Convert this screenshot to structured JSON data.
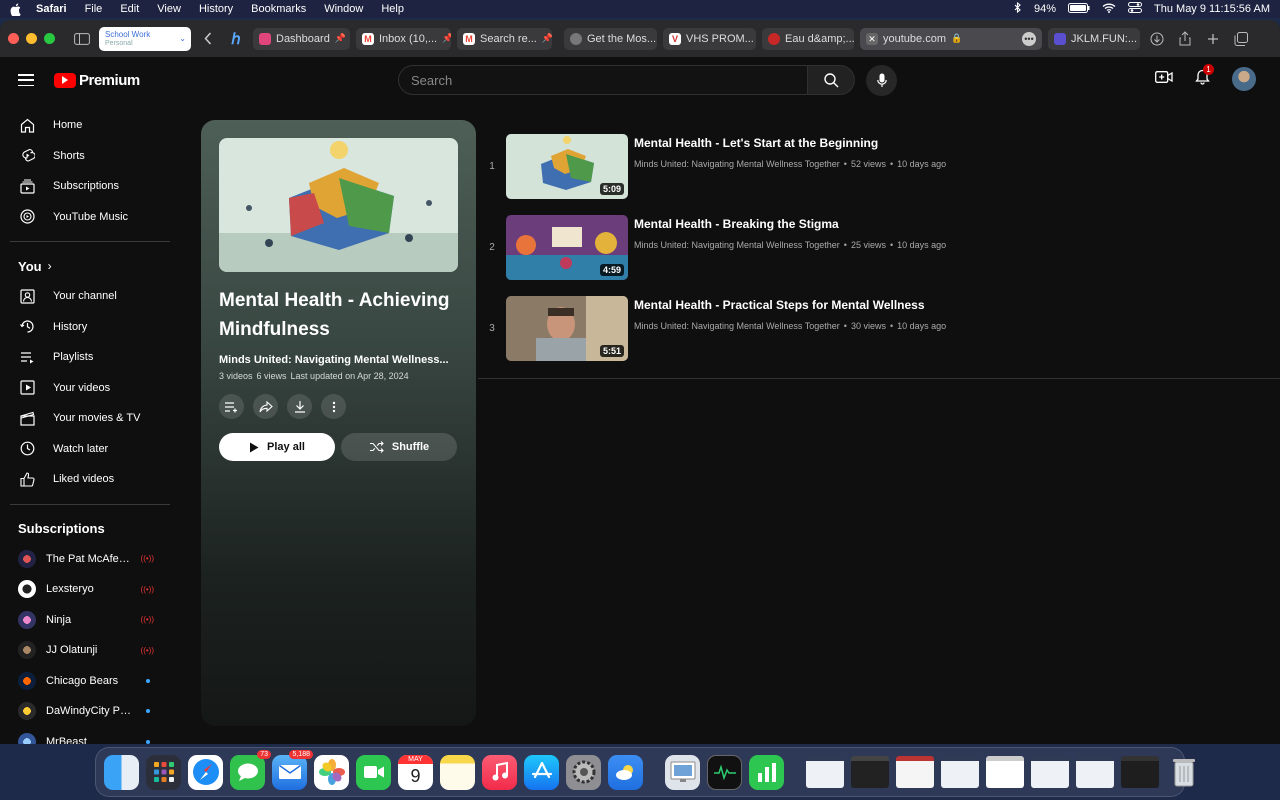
{
  "menubar": {
    "app": "Safari",
    "items": [
      "File",
      "Edit",
      "View",
      "History",
      "Bookmarks",
      "Window",
      "Help"
    ],
    "battery": "94%",
    "datetime": "Thu May 9  11:15:56 AM"
  },
  "browser": {
    "profile": {
      "name": "School Work",
      "sub": "Personal"
    },
    "tabs": [
      {
        "label": "Dashboard",
        "color": "#e0457b"
      },
      {
        "label": "Inbox (10,...",
        "color": "#ea4335"
      },
      {
        "label": "Search re...",
        "color": "#ea4335"
      },
      {
        "label": "Get the Mos...",
        "color": "#888888"
      },
      {
        "label": "VHS PROM...",
        "color": "#d32f2f"
      },
      {
        "label": "Eau d&amp;...",
        "color": "#c62828"
      },
      {
        "label": "youtube.com",
        "color": "#666666"
      },
      {
        "label": "JKLM.FUN:...",
        "color": "#5a4fcf"
      }
    ]
  },
  "yt": {
    "logo_text": "Premium",
    "search_placeholder": "Search",
    "notif_count": "1",
    "sidebar": {
      "main": [
        "Home",
        "Shorts",
        "Subscriptions",
        "YouTube Music"
      ],
      "you_header": "You",
      "you_items": [
        "Your channel",
        "History",
        "Playlists",
        "Your videos",
        "Your movies & TV",
        "Watch later",
        "Liked videos"
      ],
      "subs_header": "Subscriptions",
      "subs": [
        {
          "name": "The Pat McAfee ...",
          "status": "live"
        },
        {
          "name": "Lexsteryo",
          "status": "live"
        },
        {
          "name": "Ninja",
          "status": "live"
        },
        {
          "name": "JJ Olatunji",
          "status": "live"
        },
        {
          "name": "Chicago Bears",
          "status": "new"
        },
        {
          "name": "DaWindyCity Pro...",
          "status": "new"
        },
        {
          "name": "MrBeast",
          "status": "new"
        }
      ]
    },
    "playlist": {
      "title": "Mental Health - Achieving Mindfulness",
      "owner": "Minds United: Navigating Mental Wellness...",
      "videos_count": "3 videos",
      "views": "6 views",
      "updated": "Last updated on Apr 28, 2024",
      "play_all": "Play all",
      "shuffle": "Shuffle"
    },
    "videos": [
      {
        "index": "1",
        "title": "Mental Health - Let's Start at the Beginning",
        "channel": "Minds United: Navigating Mental Wellness Together",
        "views": "52 views",
        "age": "10 days ago",
        "duration": "5:09"
      },
      {
        "index": "2",
        "title": "Mental Health - Breaking the Stigma",
        "channel": "Minds United: Navigating Mental Wellness Together",
        "views": "25 views",
        "age": "10 days ago",
        "duration": "4:59"
      },
      {
        "index": "3",
        "title": "Mental Health - Practical Steps for Mental Wellness",
        "channel": "Minds United: Navigating Mental Wellness Together",
        "views": "30 views",
        "age": "10 days ago",
        "duration": "5:51"
      }
    ]
  },
  "dock": {
    "calendar_month": "MAY",
    "calendar_day": "9",
    "messages_badge": "73",
    "mail_badge": "5,188"
  }
}
